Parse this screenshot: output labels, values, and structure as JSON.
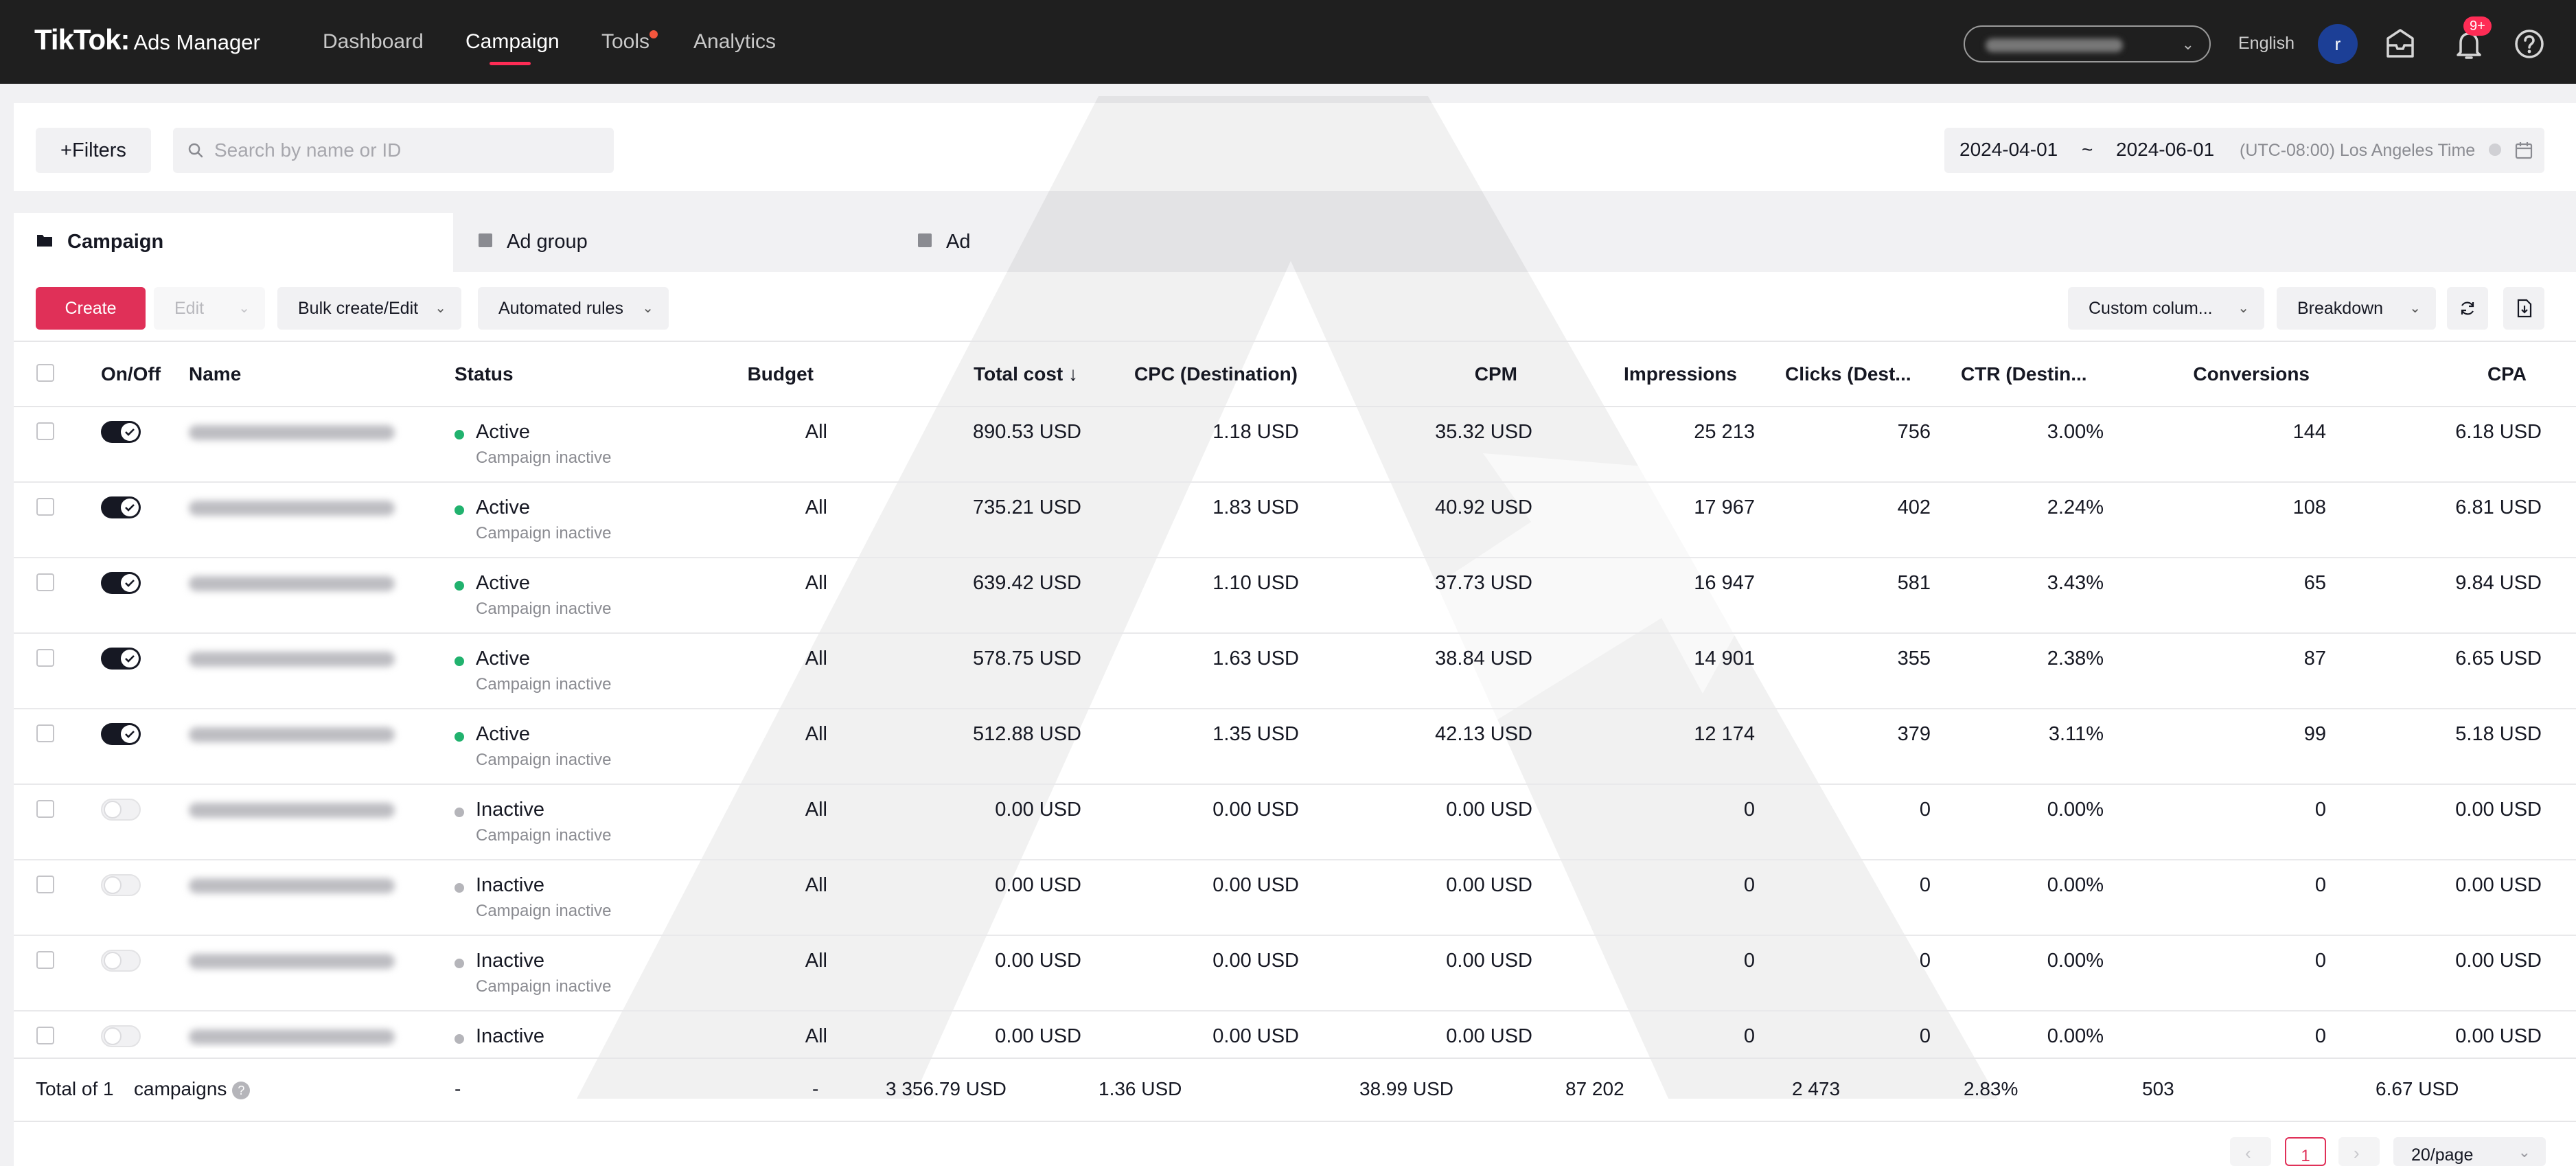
{
  "app": {
    "logo": "TikTok:",
    "logo_sub": "Ads Manager"
  },
  "nav": [
    {
      "label": "Dashboard"
    },
    {
      "label": "Campaign"
    },
    {
      "label": "Tools"
    },
    {
      "label": "Analytics"
    }
  ],
  "header": {
    "language": "English",
    "avatar_letter": "r",
    "notification_badge": "9+"
  },
  "toolbar": {
    "filters_label": "+Filters",
    "search_placeholder": "Search by name or ID",
    "date_start": "2024-04-01",
    "date_sep": "~",
    "date_end": "2024-06-01",
    "timezone": "(UTC-08:00) Los Angeles Time"
  },
  "tabs": [
    {
      "label": "Campaign"
    },
    {
      "label": "Ad group"
    },
    {
      "label": "Ad"
    }
  ],
  "actions": {
    "create": "Create",
    "edit": "Edit",
    "bulk": "Bulk create/Edit",
    "automated": "Automated rules",
    "custom_columns": "Custom colum...",
    "breakdown": "Breakdown"
  },
  "table": {
    "columns": [
      "On/Off",
      "Name",
      "Status",
      "Budget",
      "Total cost ↓",
      "CPC (Destination)",
      "CPM",
      "Impressions",
      "Clicks (Dest...",
      "CTR (Destin...",
      "Conversions",
      "CPA"
    ],
    "rows": [
      {
        "status": "Active",
        "sub": "Campaign inactive",
        "budget": "All",
        "cost": "890.53 USD",
        "cpc": "1.18  USD",
        "cpm": "35.32 USD",
        "impressions": "25 213",
        "clicks": "756",
        "ctr": "3.00%",
        "conversions": "144",
        "cpa": "6.18 USD"
      },
      {
        "status": "Active",
        "sub": "Campaign inactive",
        "budget": "All",
        "cost": "735.21 USD",
        "cpc": "1.83 USD",
        "cpm": "40.92 USD",
        "impressions": "17 967",
        "clicks": "402",
        "ctr": "2.24%",
        "conversions": "108",
        "cpa": "6.81 USD"
      },
      {
        "status": "Active",
        "sub": "Campaign inactive",
        "budget": "All",
        "cost": "639.42 USD",
        "cpc": "1.10 USD",
        "cpm": "37.73 USD",
        "impressions": "16 947",
        "clicks": "581",
        "ctr": "3.43%",
        "conversions": "65",
        "cpa": "9.84 USD"
      },
      {
        "status": "Active",
        "sub": "Campaign inactive",
        "budget": "All",
        "cost": "578.75 USD",
        "cpc": "1.63 USD",
        "cpm": "38.84 USD",
        "impressions": "14 901",
        "clicks": "355",
        "ctr": "2.38%",
        "conversions": "87",
        "cpa": "6.65 USD"
      },
      {
        "status": "Active",
        "sub": "Campaign inactive",
        "budget": "All",
        "cost": "512.88 USD",
        "cpc": "1.35  USD",
        "cpm": "42.13 USD",
        "impressions": "12 174",
        "clicks": "379",
        "ctr": "3.11%",
        "conversions": "99",
        "cpa": "5.18 USD"
      },
      {
        "status": "Inactive",
        "sub": "Campaign inactive",
        "budget": "All",
        "cost": "0.00 USD",
        "cpc": "0.00 USD",
        "cpm": "0.00 USD",
        "impressions": "0",
        "clicks": "0",
        "ctr": "0.00%",
        "conversions": "0",
        "cpa": "0.00 USD"
      },
      {
        "status": "Inactive",
        "sub": "Campaign inactive",
        "budget": "All",
        "cost": "0.00 USD",
        "cpc": "0.00 USD",
        "cpm": "0.00 USD",
        "impressions": "0",
        "clicks": "0",
        "ctr": "0.00%",
        "conversions": "0",
        "cpa": "0.00 USD"
      },
      {
        "status": "Inactive",
        "sub": "Campaign inactive",
        "budget": "All",
        "cost": "0.00 USD",
        "cpc": "0.00 USD",
        "cpm": "0.00 USD",
        "impressions": "0",
        "clicks": "0",
        "ctr": "0.00%",
        "conversions": "0",
        "cpa": "0.00 USD"
      },
      {
        "status": "Inactive",
        "sub": "",
        "budget": "All",
        "cost": "0.00 USD",
        "cpc": "0.00 USD",
        "cpm": "0.00 USD",
        "impressions": "0",
        "clicks": "0",
        "ctr": "0.00%",
        "conversions": "0",
        "cpa": "0.00 USD"
      }
    ],
    "total": {
      "label": "Total of 1",
      "label2": "campaigns",
      "status": "-",
      "budget": "-",
      "cost": "3 356.79 USD",
      "cpc": "1.36 USD",
      "cpm": "38.99 USD",
      "impressions": "87 202",
      "clicks": "2 473",
      "ctr": "2.83%",
      "conversions": "503",
      "cpa": "6.67 USD"
    }
  },
  "pagination": {
    "current_page": "1",
    "page_size": "20/page"
  },
  "colors": {
    "brand": "#fe2c55",
    "create": "#e03058",
    "active_dot": "#21b26e",
    "inactive_dot": "#b5b5ba",
    "topbar": "#1f1f1f"
  }
}
